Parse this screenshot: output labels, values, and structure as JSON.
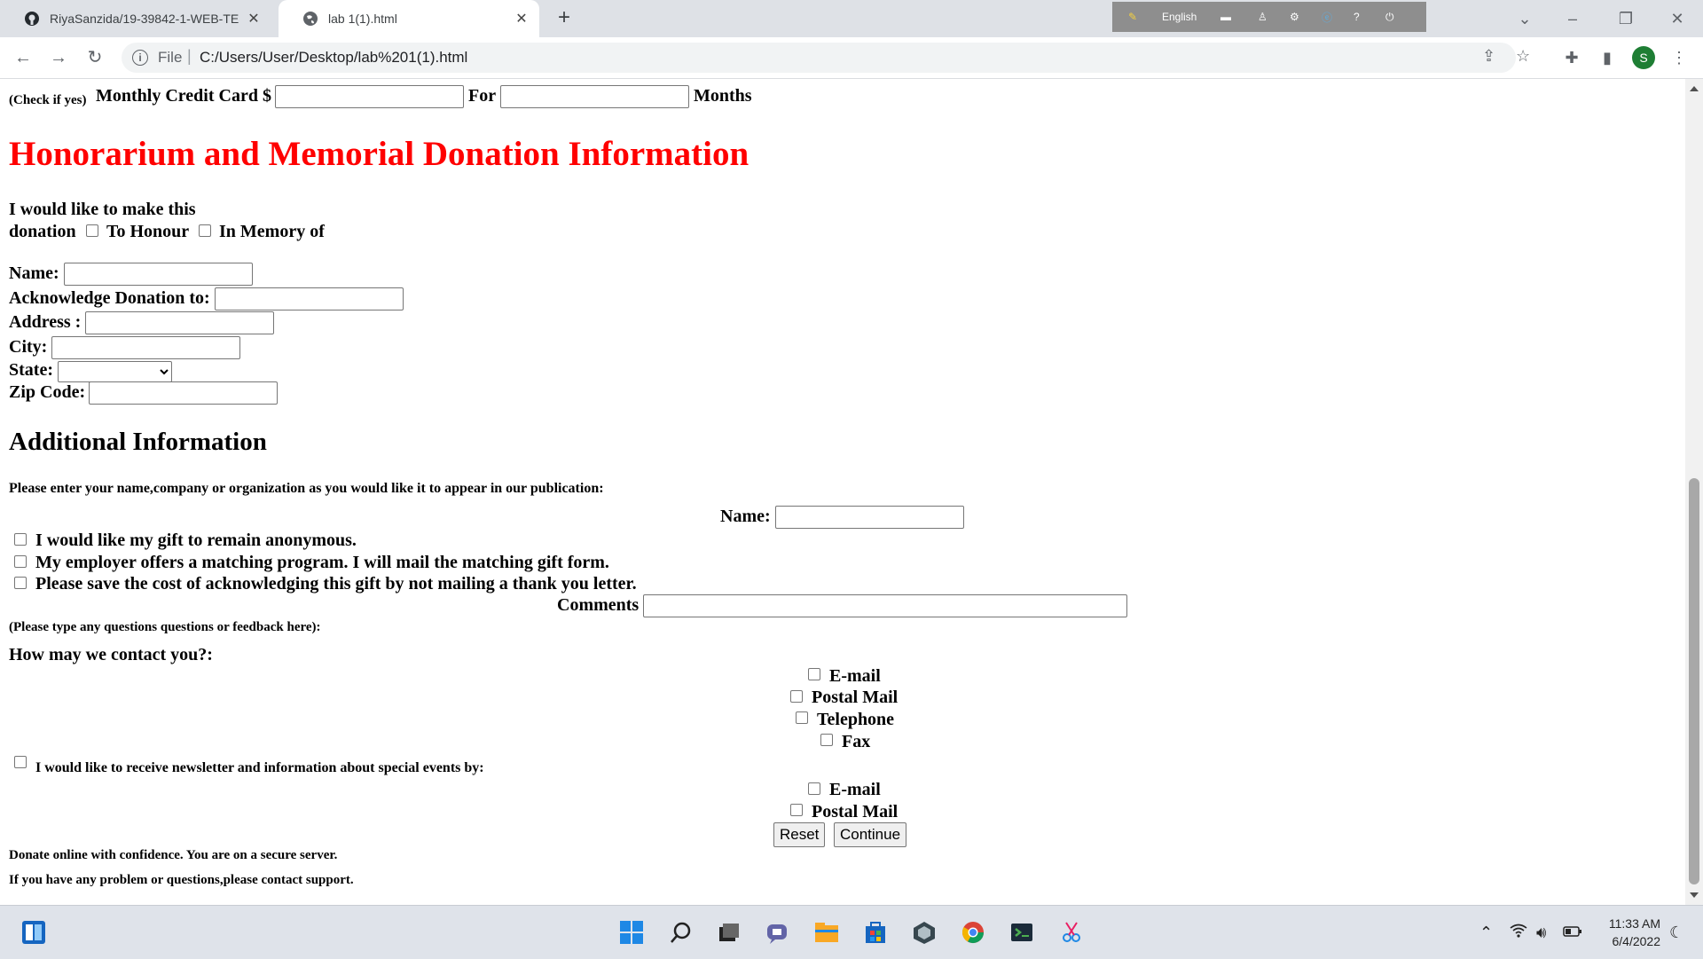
{
  "browser": {
    "tabs": [
      {
        "title": "RiyaSanzida/19-39842-1-WEB-TE",
        "icon": "github-icon"
      },
      {
        "title": "lab 1(1).html",
        "icon": "globe-icon"
      }
    ],
    "url_scheme": "File",
    "url": "C:/Users/User/Desktop/lab%201(1).html",
    "language_bar_label": "English",
    "profile_initial": "S"
  },
  "page": {
    "check_if_yes": "(Check if yes)",
    "monthly_credit_card_label": "Monthly Credit Card $",
    "for_label": "For",
    "months_label": "Months",
    "honorarium_title": "Honorarium and Memorial Donation Information",
    "donation_line1": "I would like to make this",
    "donation_line2": "donation",
    "to_honour": "To Honour",
    "in_memory_of": "In Memory of",
    "name_label": "Name:",
    "acknowledge_label": "Acknowledge Donation to:",
    "address_label": "Address :",
    "city_label": "City:",
    "state_label": "State:",
    "state_value": "",
    "zip_label": "Zip Code:",
    "additional_title": "Additional Information",
    "publication_prompt": "Please enter your name,company or organization as you would like it to appear in our publication:",
    "pub_name_label": "Name:",
    "anonymous_label": "I would like my gift to remain anonymous.",
    "employer_label": "My employer offers a matching program. I will mail the matching gift form.",
    "save_cost_label": "Please save the cost of acknowledging this gift by not mailing a thank you letter.",
    "comments_label": "Comments",
    "comments_hint": "(Please type any questions questions or feedback here):",
    "contact_prompt": "How may we contact you?:",
    "contact_options": [
      "E-mail",
      "Postal Mail",
      "Telephone",
      "Fax"
    ],
    "newsletter_label": "I would like to receive newsletter and information about special events by:",
    "newsletter_options": [
      "E-mail",
      "Postal Mail"
    ],
    "reset_button": "Reset",
    "continue_button": "Continue",
    "secure_note": "Donate online with confidence. You are on a secure server.",
    "support_note": "If you have any problem or questions,please contact support."
  },
  "taskbar": {
    "time": "11:33 AM",
    "date": "6/4/2022"
  },
  "colors": {
    "heading_red": "#ff0000",
    "tab_strip": "#dee1e6",
    "taskbar": "#dfe3ea"
  }
}
